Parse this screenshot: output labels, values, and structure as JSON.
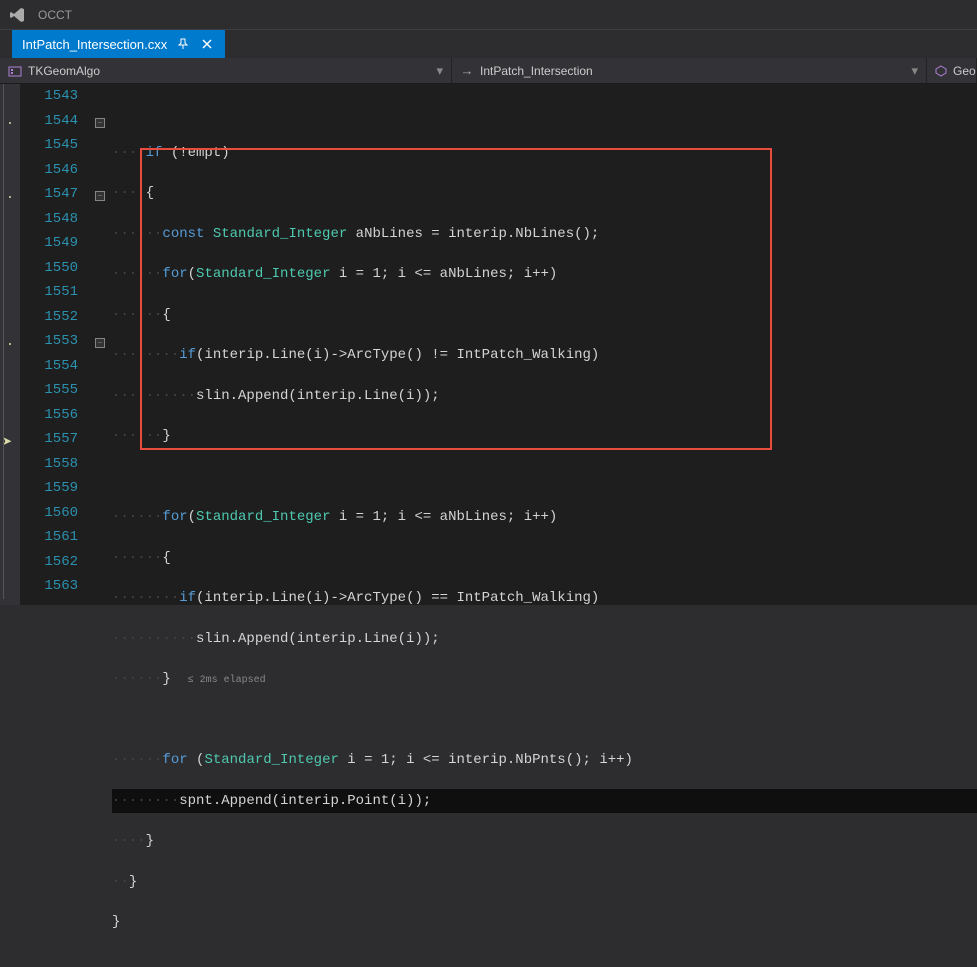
{
  "title": "OCCT",
  "tab": {
    "name": "IntPatch_Intersection.cxx"
  },
  "nav": {
    "project": "TKGeomAlgo",
    "scope": "IntPatch_Intersection",
    "member": "Geo"
  },
  "lines": {
    "start": 1543,
    "end": 1563
  },
  "code": {
    "l1543": "",
    "l1544_kw": "if",
    "l1544_rest": " (!empt)",
    "l1545": "{",
    "l1546_kw": "const",
    "l1546_typ": "Standard_Integer",
    "l1546_rest": " aNbLines = interip.NbLines();",
    "l1547_kw": "for",
    "l1547_typ": "Standard_Integer",
    "l1547_rest1": "(",
    "l1547_rest2": " i = 1; i <= aNbLines; i++)",
    "l1548": "{",
    "l1549_kw": "if",
    "l1549_rest": "(interip.Line(i)->ArcType() != IntPatch_Walking)",
    "l1550": "slin.Append(interip.Line(i));",
    "l1551": "}",
    "l1552": "",
    "l1553_kw": "for",
    "l1553_typ": "Standard_Integer",
    "l1553_rest1": "(",
    "l1553_rest2": " i = 1; i <= aNbLines; i++)",
    "l1554": "{",
    "l1555_kw": "if",
    "l1555_rest": "(interip.Line(i)->ArcType() == IntPatch_Walking)",
    "l1556": "slin.Append(interip.Line(i));",
    "l1557": "}",
    "l1557_elapsed": "≤ 2ms elapsed",
    "l1558": "",
    "l1559_kw": "for",
    "l1559_typ": "Standard_Integer",
    "l1559_rest1": " (",
    "l1559_rest2": " i = 1; i <= interip.NbPnts(); i++)",
    "l1560": "spnt.Append(interip.Point(i));",
    "l1561": "}",
    "l1562": "}",
    "l1563": "}"
  }
}
